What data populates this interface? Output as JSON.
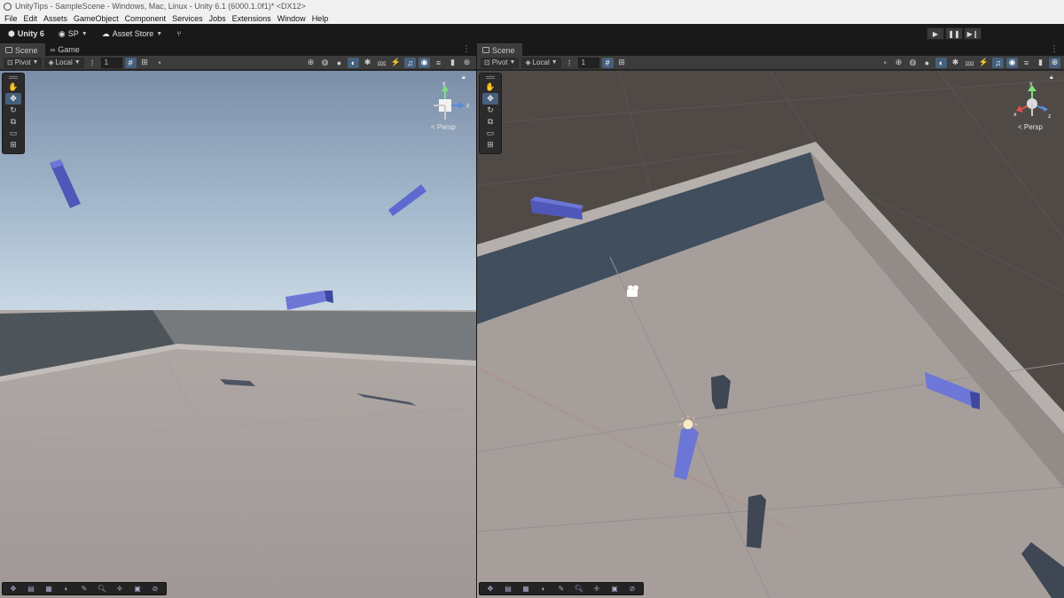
{
  "window": {
    "title": "UnityTips - SampleScene - Windows, Mac, Linux - Unity 6.1 (6000.1.0f1)* <DX12>"
  },
  "menu": [
    "File",
    "Edit",
    "Assets",
    "GameObject",
    "Component",
    "Services",
    "Jobs",
    "Extensions",
    "Window",
    "Help"
  ],
  "toolbar": {
    "unity_label": "Unity 6",
    "account_label": "SP",
    "asset_store_label": "Asset Store"
  },
  "left_panel": {
    "tabs": [
      "Scene",
      "Game"
    ],
    "pivot_label": "Pivot",
    "local_label": "Local",
    "grid_value": "1",
    "persp_label": "< Persp"
  },
  "right_panel": {
    "tabs": [
      "Scene"
    ],
    "pivot_label": "Pivot",
    "local_label": "Local",
    "grid_value": "1",
    "persp_label": "< Persp"
  },
  "colors": {
    "sky_top": "#7f92ad",
    "sky_horizon": "#c4d5e3",
    "floor": "#a8a19f",
    "wall_dark": "#4a5157",
    "block_blue": "#5c66c8",
    "tool_active": "#46607c"
  },
  "icons": [
    "unity-logo-icon",
    "account-icon",
    "cloud-icon",
    "play-icon",
    "pause-icon",
    "step-icon",
    "hand-tool-icon",
    "move-tool-icon",
    "rotate-tool-icon",
    "scale-tool-icon",
    "rect-tool-icon",
    "transform-tool-icon"
  ]
}
